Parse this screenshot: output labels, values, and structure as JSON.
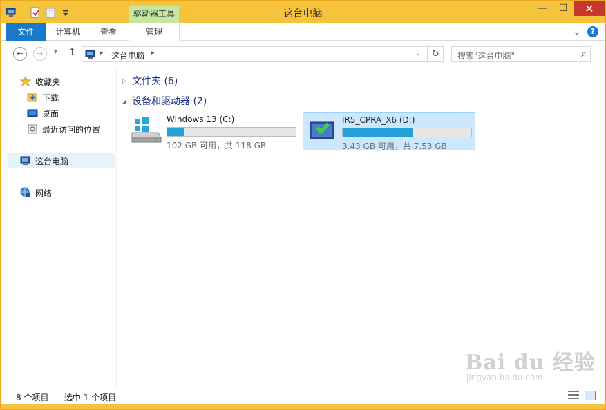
{
  "window": {
    "title": "这台电脑",
    "context_tab": "驱动器工具",
    "buttons": {
      "minimize": "—",
      "maximize": "☐",
      "close": "✕"
    }
  },
  "ribbon": {
    "tabs": [
      {
        "label": "文件"
      },
      {
        "label": "计算机"
      },
      {
        "label": "查看"
      },
      {
        "label": "管理"
      }
    ],
    "collapse": "⌄",
    "help": "?"
  },
  "address": {
    "back": "←",
    "forward": "→",
    "recent": "▾",
    "up": "↑",
    "breadcrumb": "这台电脑",
    "crumb_arrow": "▸",
    "dropdown": "⌄",
    "refresh": "↻",
    "search_placeholder": "搜索\"这台电脑\"",
    "search_icon": "⌕"
  },
  "nav": {
    "favorites": "收藏夹",
    "downloads": "下载",
    "desktop": "桌面",
    "recent_places": "最近访问的位置",
    "this_pc": "这台电脑",
    "network": "网络"
  },
  "groups": {
    "folders": {
      "label": "文件夹 (6)",
      "expanded": false
    },
    "devices": {
      "label": "设备和驱动器 (2)",
      "expanded": true
    }
  },
  "drives": [
    {
      "name": "Windows 13 (C:)",
      "info": "102 GB 可用，共 118 GB",
      "used_fraction": 0.136,
      "selected": false
    },
    {
      "name": "IR5_CPRA_X6 (D:)",
      "info": "3.43 GB 可用，共 7.53 GB",
      "used_fraction": 0.545,
      "selected": true
    }
  ],
  "status": {
    "items": "8 个项目",
    "selected": "选中 1 个项目"
  },
  "watermark": {
    "brand": "Bai du 经验",
    "url": "jingyan.baidu.com"
  },
  "colors": {
    "frame": "#f6c33d",
    "accent": "#1979ca",
    "context_tab": "#c5e7a0",
    "bar_fill": "#26a0da",
    "close": "#c8372d"
  }
}
